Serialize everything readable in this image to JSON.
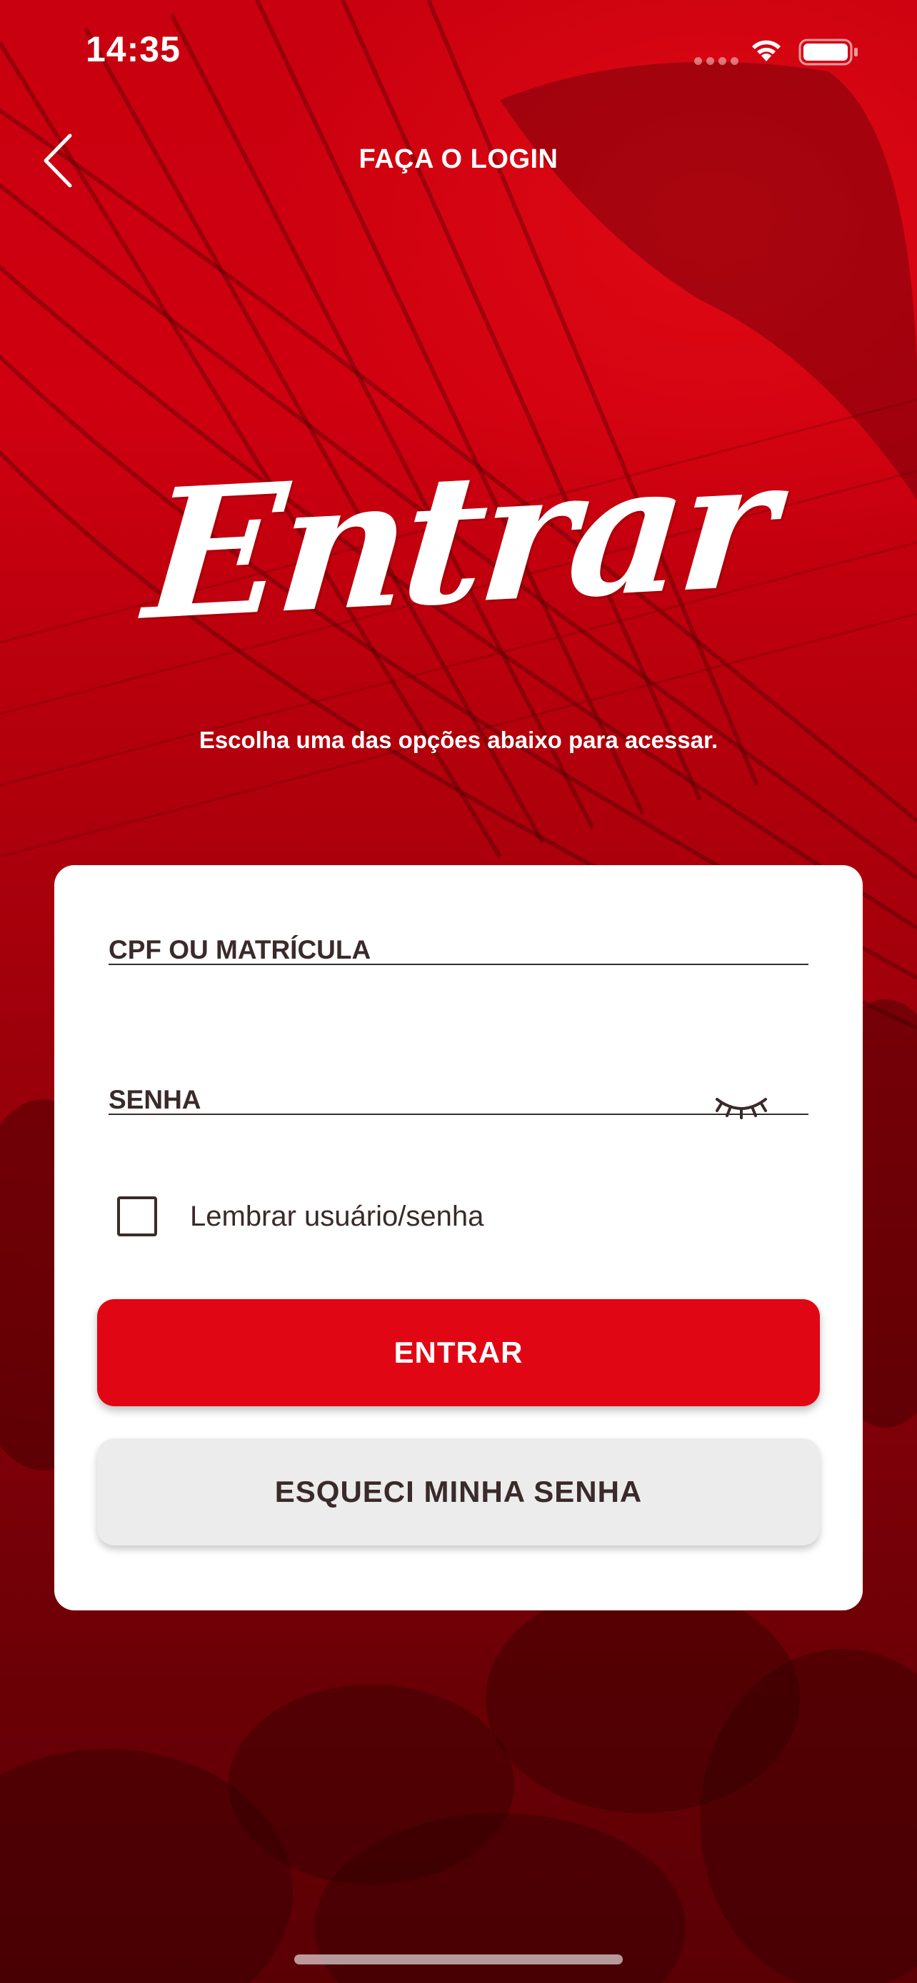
{
  "status_bar": {
    "time": "14:35",
    "wifi_icon": "wifi-icon",
    "battery_icon": "battery-icon"
  },
  "nav": {
    "title": "FAÇA O LOGIN",
    "back_icon": "chevron-left-icon"
  },
  "hero": {
    "title": "Entrar",
    "subtitle": "Escolha uma das opções abaixo para acessar."
  },
  "form": {
    "cpf_label": "CPF OU MATRÍCULA",
    "cpf_value": "",
    "senha_label": "SENHA",
    "senha_value": "",
    "eye_icon": "eye-closed-icon",
    "remember_label": "Lembrar usuário/senha",
    "remember_checked": false
  },
  "buttons": {
    "primary_label": "ENTRAR",
    "secondary_label": "ESQUECI MINHA SENHA"
  },
  "colors": {
    "brand_red": "#e10613",
    "text_dark": "#3a2a2a",
    "secondary_bg": "#ececec"
  }
}
